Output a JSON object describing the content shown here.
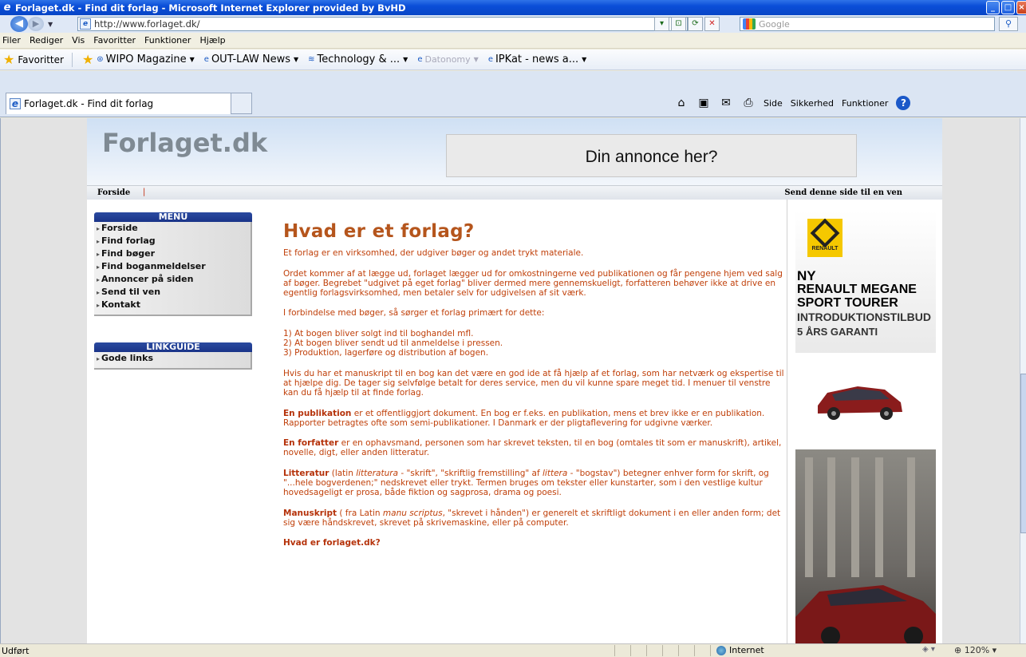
{
  "window": {
    "title": "Forlaget.dk - Find dit forlag - Microsoft Internet Explorer provided by BvHD"
  },
  "address": {
    "url": "http://www.forlaget.dk/",
    "search_placeholder": "Google"
  },
  "menubar": [
    "Filer",
    "Rediger",
    "Vis",
    "Favoritter",
    "Funktioner",
    "Hjælp"
  ],
  "favorites": {
    "label": "Favoritter",
    "items": [
      "WIPO Magazine",
      "OUT-LAW News",
      "Technology & ...",
      "Datonomy",
      "IPKat - news a..."
    ]
  },
  "tab": {
    "label": "Forlaget.dk - Find dit forlag"
  },
  "commandbar": {
    "side": "Side",
    "sikkerhed": "Sikkerhed",
    "funktioner": "Funktioner"
  },
  "site": {
    "logo": "Forlaget.dk",
    "ad_text": "Din annonce her?",
    "topnav_home": "Forside",
    "topnav_pipe": "|",
    "topnav_send": "Send denne side til en ven",
    "menu_title": "MENU",
    "menu_items": [
      "Forside",
      "Find forlag",
      "Find bøger",
      "Find boganmeldelser",
      "Annoncer på siden",
      "Send til ven",
      "Kontakt"
    ],
    "linkguide_title": "LINKGUIDE",
    "linkguide_items": [
      "Gode links"
    ]
  },
  "article": {
    "heading": "Hvad er et forlag?",
    "p1": "Et forlag er en virksomhed, der udgiver bøger og andet trykt materiale.",
    "p2": "Ordet kommer af at lægge ud, forlaget lægger ud for omkostningerne ved publikationen og får pengene hjem ved salg af bøger. Begrebet \"udgivet på eget forlag\" bliver dermed mere gennemskueligt, forfatteren behøver ikke at drive en egentlig forlagsvirksomhed, men betaler selv for udgivelsen af sit værk.",
    "p3": "I forbindelse med bøger, så sørger et forlag primært for dette:",
    "list": [
      "1) At bogen bliver solgt ind til boghandel mfl.",
      "2) At bogen bliver sendt ud til anmeldelse i pressen.",
      "3) Produktion, lagerføre og distribution af bogen."
    ],
    "p4": "Hvis du har et manuskript til en bog kan det være en god ide at få hjælp af et forlag, som har netværk og ekspertise til at hjælpe dig. De tager sig selvfølge betalt for deres service, men du vil kunne spare meget tid. I menuer til venstre kan du få hjælp til at finde forlag.",
    "p5_term": "En publikation",
    "p5": " er et offentliggjort dokument. En bog er f.eks. en publikation, mens et brev ikke er en publikation. Rapporter betragtes ofte som semi-publikationer. I Danmark er der pligtaflevering for udgivne værker.",
    "p6_term": "En forfatter",
    "p6": " er en ophavsmand, personen som har skrevet teksten, til en bog (omtales tit som er manuskrift), artikel, novelle, digt, eller anden litteratur.",
    "p7_term": "Litteratur",
    "p7a": " (latin ",
    "p7_it1": "litteratura",
    "p7b": " - \"skrift\", \"skriftlig fremstilling\" af ",
    "p7_it2": "littera",
    "p7c": " - \"bogstav\") betegner enhver form for skrift, og \"...hele bogverdenen;\" nedskrevet eller trykt. Termen bruges om tekster eller kunstarter, som i den vestlige kultur hovedsageligt er prosa, både fiktion og sagprosa, drama og poesi.",
    "p8_term": "Manuskript",
    "p8a": " ( fra Latin ",
    "p8_it": "manu scriptus",
    "p8b": ", \"skrevet i hånden\") er generelt et skriftligt dokument i en eller anden form; det sig være håndskrevet, skrevet på skrivemaskine, eller på computer.",
    "p9_heading": "Hvad er forlaget.dk?"
  },
  "ad": {
    "brand": "RENAULT",
    "line1": "NY",
    "line2": "RENAULT MEGANE",
    "line3": "SPORT TOURER",
    "line4": "INTRODUKTIONSTILBUD",
    "line5": "5 ÅRS GARANTI"
  },
  "status": {
    "text": "Udført",
    "zone": "Internet",
    "zoom": "120%"
  },
  "colors": {
    "article_text": "#c0400a",
    "heading": "#b5551c",
    "menu_header": "#1a3488"
  }
}
